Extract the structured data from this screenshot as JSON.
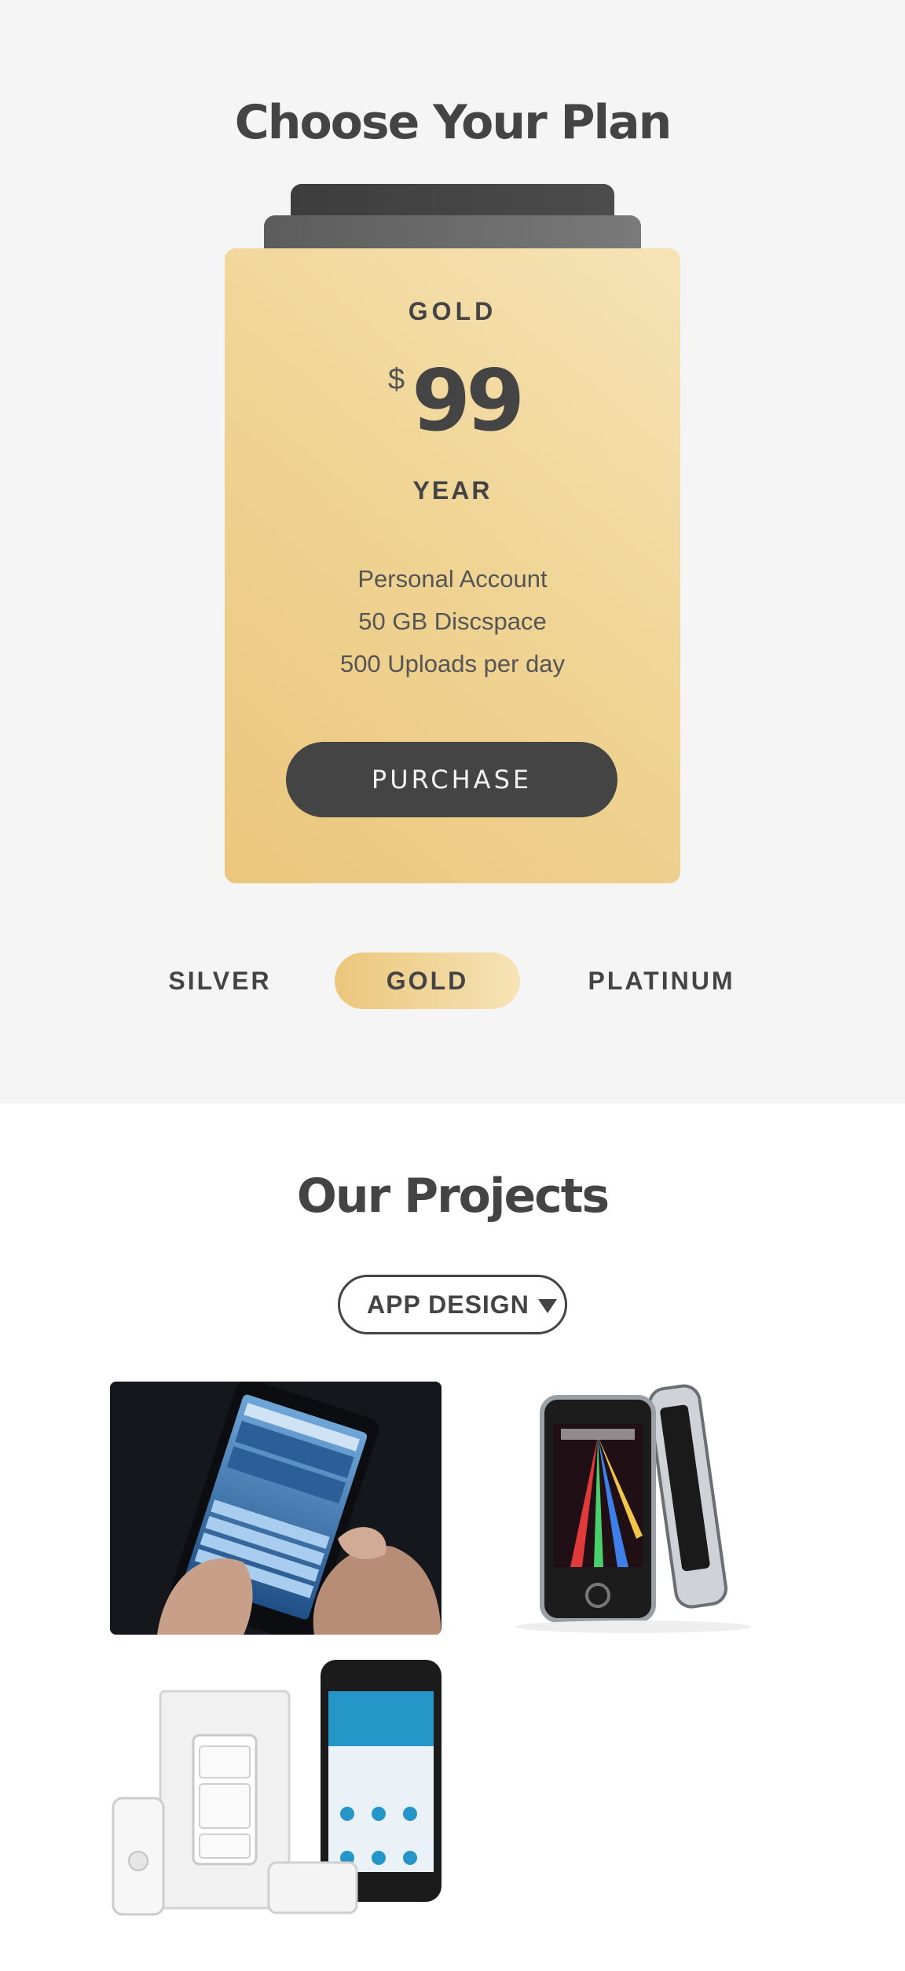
{
  "pricing": {
    "title": "Choose Your Plan",
    "card": {
      "plan_name": "GOLD",
      "currency": "$",
      "amount": "99",
      "period": "YEAR",
      "features": [
        "Personal Account",
        "50 GB Discspace",
        "500 Uploads per day"
      ],
      "button_label": "PURCHASE"
    },
    "tabs": [
      {
        "label": "SILVER",
        "active": false
      },
      {
        "label": "GOLD",
        "active": true
      },
      {
        "label": "PLATINUM",
        "active": false
      }
    ],
    "colors": {
      "gold_light": "#f6e3b6",
      "gold_dark": "#ebc67c",
      "dark": "#444444",
      "background": "#f5f5f5"
    }
  },
  "projects": {
    "title": "Our Projects",
    "filter": {
      "label": "APP DESIGN",
      "icon": "caret-down-icon"
    },
    "items": [
      {
        "image": "phone-keyboard-photo"
      },
      {
        "image": "music-player-device-photo"
      },
      {
        "image": "smart-home-switch-app-photo"
      }
    ]
  }
}
